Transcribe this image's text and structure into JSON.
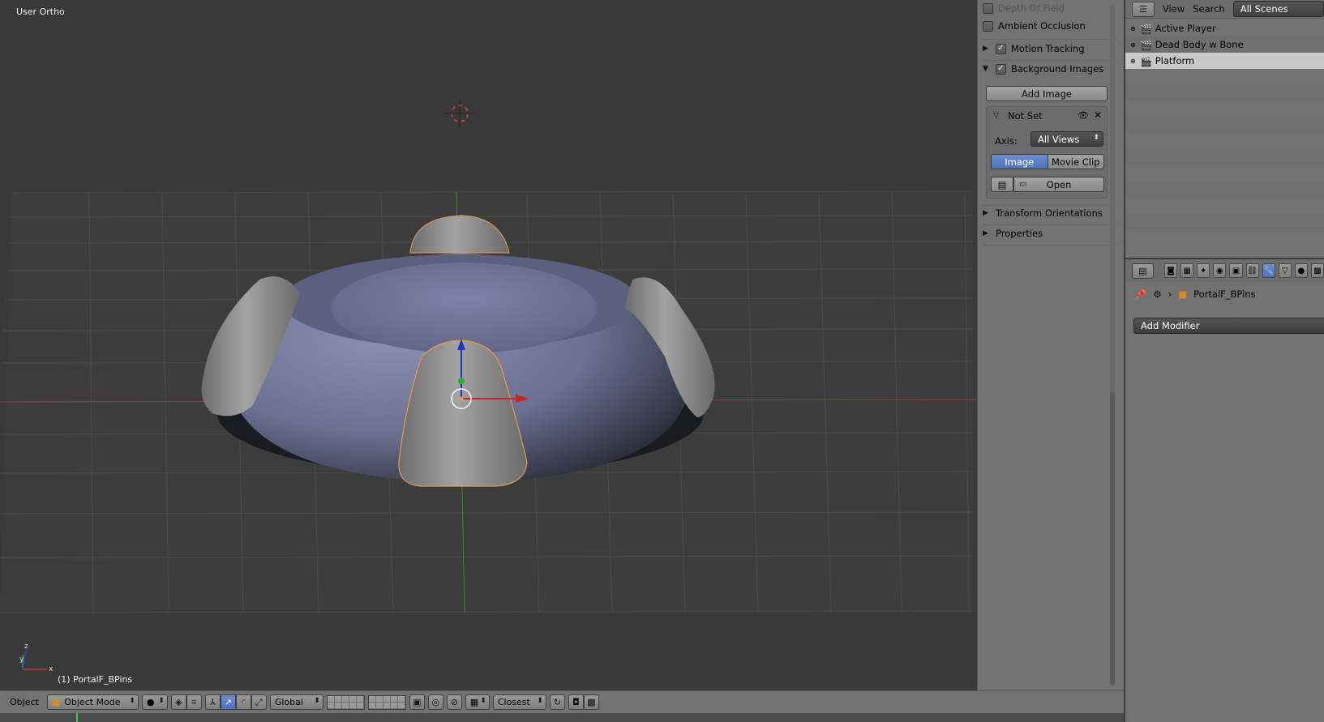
{
  "viewport": {
    "view_name": "User Ortho",
    "object_label": "(1) PortalF_BPins",
    "axis_labels": {
      "x": "x",
      "y": "y",
      "z": "z"
    },
    "colors": {
      "background": "#393939",
      "grid": "#4a4a4a",
      "x_axis": "#9e3b3b",
      "y_axis": "#3e8a3e",
      "selection": "#e89a4e"
    }
  },
  "header3d": {
    "menu_label": "Object",
    "mode_label": "Object Mode",
    "orientation_label": "Global",
    "snap_label": "Closest"
  },
  "npanel": {
    "depth_of_field": "Depth Of Field",
    "ambient_occlusion": "Ambient Occlusion",
    "motion_tracking": "Motion Tracking",
    "background_images": "Background Images",
    "add_image": "Add Image",
    "bg_item_name": "Not Set",
    "axis_label": "Axis:",
    "axis_value": "All Views",
    "source_image": "Image",
    "source_movie": "Movie Clip",
    "open_label": "Open",
    "transform_orientations": "Transform Orientations",
    "properties": "Properties"
  },
  "outliner": {
    "menu": {
      "view": "View",
      "search": "Search"
    },
    "scene_filter": "All Scenes",
    "items": [
      {
        "label": "Active Player"
      },
      {
        "label": "Dead Body w Bone"
      },
      {
        "label": "Platform"
      }
    ]
  },
  "properties_editor": {
    "object_name": "PortalF_BPins",
    "add_modifier": "Add Modifier",
    "accent": "#5680c2"
  }
}
